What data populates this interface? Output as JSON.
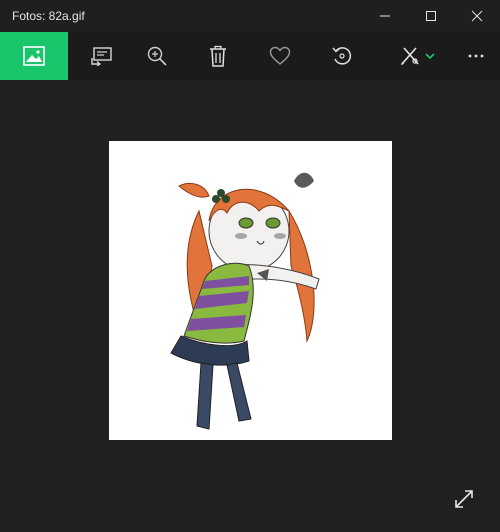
{
  "window": {
    "title": "Fotos: 82a.gif"
  },
  "toolbar": {
    "accent_color": "#18c56a",
    "items": [
      {
        "icon": "image-icon",
        "name": "view-photo"
      },
      {
        "icon": "slideshow-icon",
        "name": "slideshow"
      },
      {
        "icon": "zoom-in-icon",
        "name": "zoom-in"
      },
      {
        "icon": "trash-icon",
        "name": "delete"
      },
      {
        "icon": "heart-icon",
        "name": "favorite"
      },
      {
        "icon": "rotate-icon",
        "name": "rotate"
      },
      {
        "icon": "edit-pencil-icon",
        "name": "edit-and-create"
      },
      {
        "icon": "more-icon",
        "name": "more"
      }
    ]
  },
  "viewer": {
    "image_description_visible": "",
    "expand_icon": "expand-icon"
  }
}
